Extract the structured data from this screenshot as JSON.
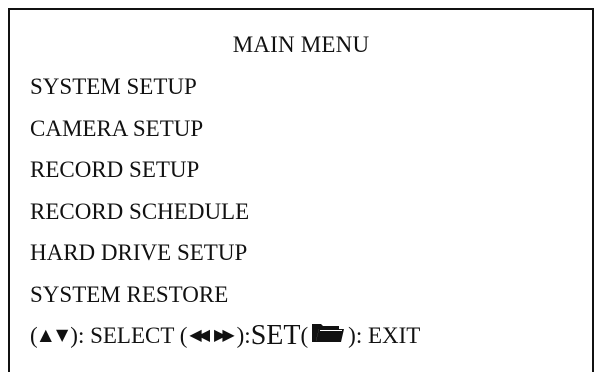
{
  "menu": {
    "title": "MAIN MENU",
    "items": [
      {
        "label": "SYSTEM SETUP"
      },
      {
        "label": "CAMERA SETUP"
      },
      {
        "label": "RECORD SETUP"
      },
      {
        "label": "RECORD SCHEDULE"
      },
      {
        "label": "HARD DRIVE SETUP"
      },
      {
        "label": "SYSTEM RESTORE"
      }
    ]
  },
  "help": {
    "open_paren_1": "(",
    "up_glyph": "▲",
    "down_glyph": "▼",
    "select_text": "): SELECT (",
    "left_glyph": "◀◀",
    "right_glyph": "▶▶",
    "set_prefix": "): ",
    "set_text": "SET",
    "set_suffix": " (",
    "exit_text": "): EXIT",
    "icons": [
      "up-arrow-icon",
      "down-arrow-icon",
      "rewind-icon",
      "fast-forward-icon",
      "folder-icon"
    ]
  }
}
